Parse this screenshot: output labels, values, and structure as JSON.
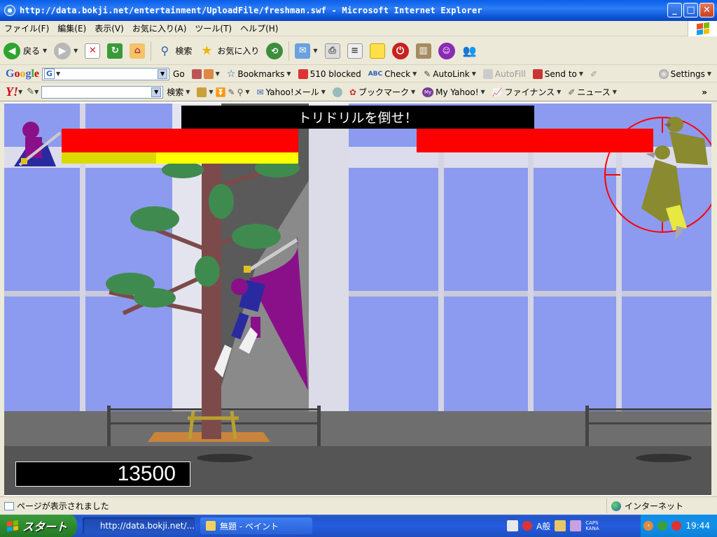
{
  "window": {
    "title": "http://data.bokji.net/entertainment/UploadFile/freshman.swf - Microsoft Internet Explorer",
    "buttons": {
      "minimize": "_",
      "maximize": "□",
      "close": "✕"
    }
  },
  "menu": {
    "items": [
      "ファイル(F)",
      "編集(E)",
      "表示(V)",
      "お気に入り(A)",
      "ツール(T)",
      "ヘルプ(H)"
    ]
  },
  "toolbar": {
    "back_label": "戻る",
    "search_label": "検索",
    "favorites_label": "お気に入り"
  },
  "google_bar": {
    "logo": "Google",
    "engine_button": "G",
    "go_label": "Go",
    "bookmarks_label": "Bookmarks",
    "blocked_label": "510 blocked",
    "check_label": "Check",
    "autolink_label": "AutoLink",
    "autofill_label": "AutoFill",
    "sendto_label": "Send to",
    "settings_label": "Settings"
  },
  "yahoo_bar": {
    "logo": "Y!",
    "search_button": "検索",
    "mail_label": "Yahoo!メール",
    "bookmark_label": "ブックマーク",
    "myyahoo_label": "My Yahoo!",
    "finance_label": "ファイナンス",
    "news_label": "ニュース",
    "more": "»"
  },
  "game": {
    "mission_text": "トリドリルを倒せ！",
    "score": "13500",
    "player_hp": 1.0,
    "player_special": 0.4,
    "boss_hp": 1.0,
    "colors": {
      "sky": "#8c9bef",
      "hp": "#ff0000",
      "special": "#ffff00",
      "ground": "#6e6e6e",
      "road": "#555555"
    }
  },
  "statusbar": {
    "text": "ページが表示されました",
    "zone": "インターネット"
  },
  "taskbar": {
    "start_label": "スタート",
    "tasks": [
      "http://data.bokji.net/...",
      "無題 - ペイント"
    ],
    "ime_label": "A般",
    "caps_label": "CAPS",
    "kana_label": "KANA",
    "clock": "19:44"
  }
}
